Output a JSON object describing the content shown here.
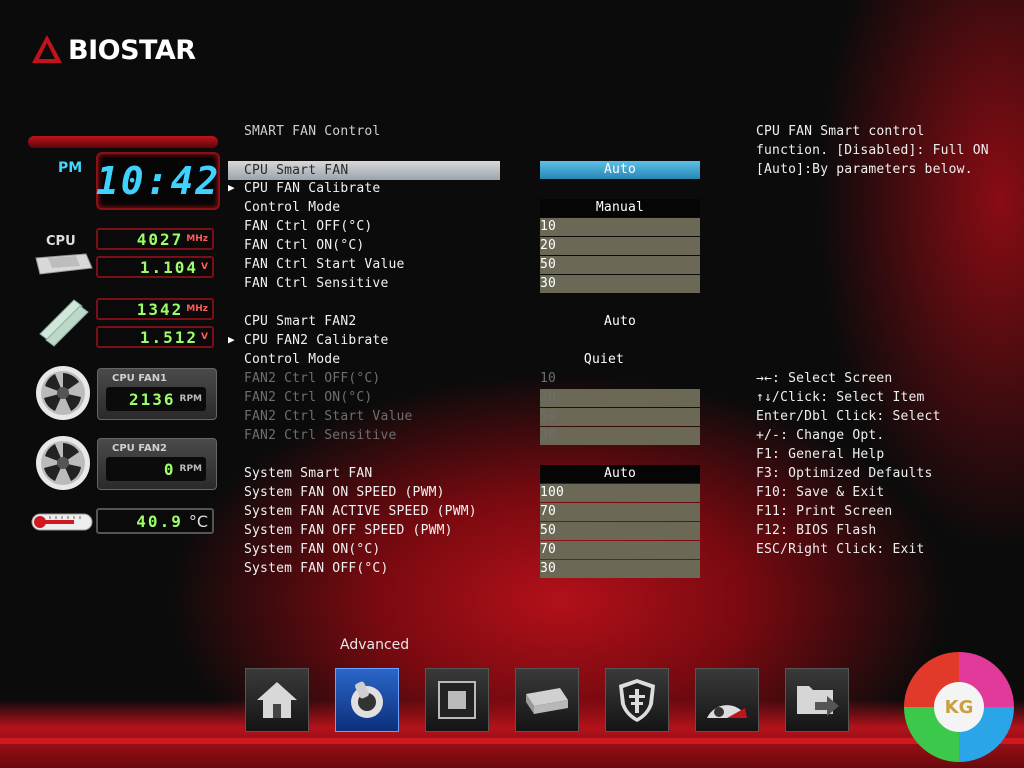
{
  "brand": {
    "name": "BIOSTAR",
    "accent": "#c0141c"
  },
  "clock": {
    "ampm": "PM",
    "time": "10:42"
  },
  "monitor": {
    "cpu_label": "CPU",
    "cpu_freq": "4027",
    "cpu_freq_unit": "MHz",
    "cpu_volt": "1.104",
    "cpu_volt_unit": "V",
    "mem_freq": "1342",
    "mem_freq_unit": "MHz",
    "mem_volt": "1.512",
    "mem_volt_unit": "V",
    "fan1": {
      "title": "CPU FAN1",
      "value": "2136",
      "unit": "RPM"
    },
    "fan2": {
      "title": "CPU FAN2",
      "value": "0",
      "unit": "RPM"
    },
    "temp": {
      "value": "40.9",
      "unit": "°C"
    }
  },
  "section_title": "SMART FAN Control",
  "rows": [
    {
      "label": "CPU Smart FAN",
      "value": "Auto"
    },
    {
      "label": "CPU FAN Calibrate",
      "value": ""
    },
    {
      "label": "Control Mode",
      "value": "Manual"
    },
    {
      "label": "FAN Ctrl OFF(°C)",
      "value": "10"
    },
    {
      "label": "FAN Ctrl ON(°C)",
      "value": "20"
    },
    {
      "label": "FAN Ctrl Start Value",
      "value": "50"
    },
    {
      "label": "FAN Ctrl Sensitive",
      "value": "30"
    },
    {
      "label": "CPU Smart FAN2",
      "value": "Auto"
    },
    {
      "label": "CPU FAN2 Calibrate",
      "value": ""
    },
    {
      "label": "Control Mode",
      "value": "Quiet"
    },
    {
      "label": "FAN2 Ctrl OFF(°C)",
      "value": "10"
    },
    {
      "label": "FAN2 Ctrl ON(°C)",
      "value": "20"
    },
    {
      "label": "FAN2 Ctrl Start Value",
      "value": "50"
    },
    {
      "label": "FAN2 Ctrl Sensitive",
      "value": "30"
    },
    {
      "label": "System Smart FAN",
      "value": "Auto"
    },
    {
      "label": "System FAN ON SPEED (PWM)",
      "value": "100"
    },
    {
      "label": "System FAN ACTIVE SPEED (PWM)",
      "value": "70"
    },
    {
      "label": "System FAN OFF SPEED (PWM)",
      "value": "50"
    },
    {
      "label": "System FAN ON(°C)",
      "value": "70"
    },
    {
      "label": "System FAN OFF(°C)",
      "value": "30"
    }
  ],
  "help": {
    "description": [
      "CPU FAN Smart control",
      "function. [Disabled]: Full ON",
      "[Auto]:By parameters below."
    ],
    "keys": [
      "→←: Select Screen",
      "↑↓/Click: Select Item",
      "Enter/Dbl Click: Select",
      "+/-: Change Opt.",
      "F1: General Help",
      "F3: Optimized Defaults",
      "F10: Save & Exit",
      "F11: Print Screen",
      "F12: BIOS Flash",
      "ESC/Right Click: Exit"
    ]
  },
  "nav": {
    "active_label": "Advanced",
    "items": [
      "home-icon",
      "advanced-icon",
      "chipset-icon",
      "boot-icon",
      "security-icon",
      "o-n-e-icon",
      "save-exit-icon"
    ]
  },
  "watermark": {
    "text": "KG"
  }
}
